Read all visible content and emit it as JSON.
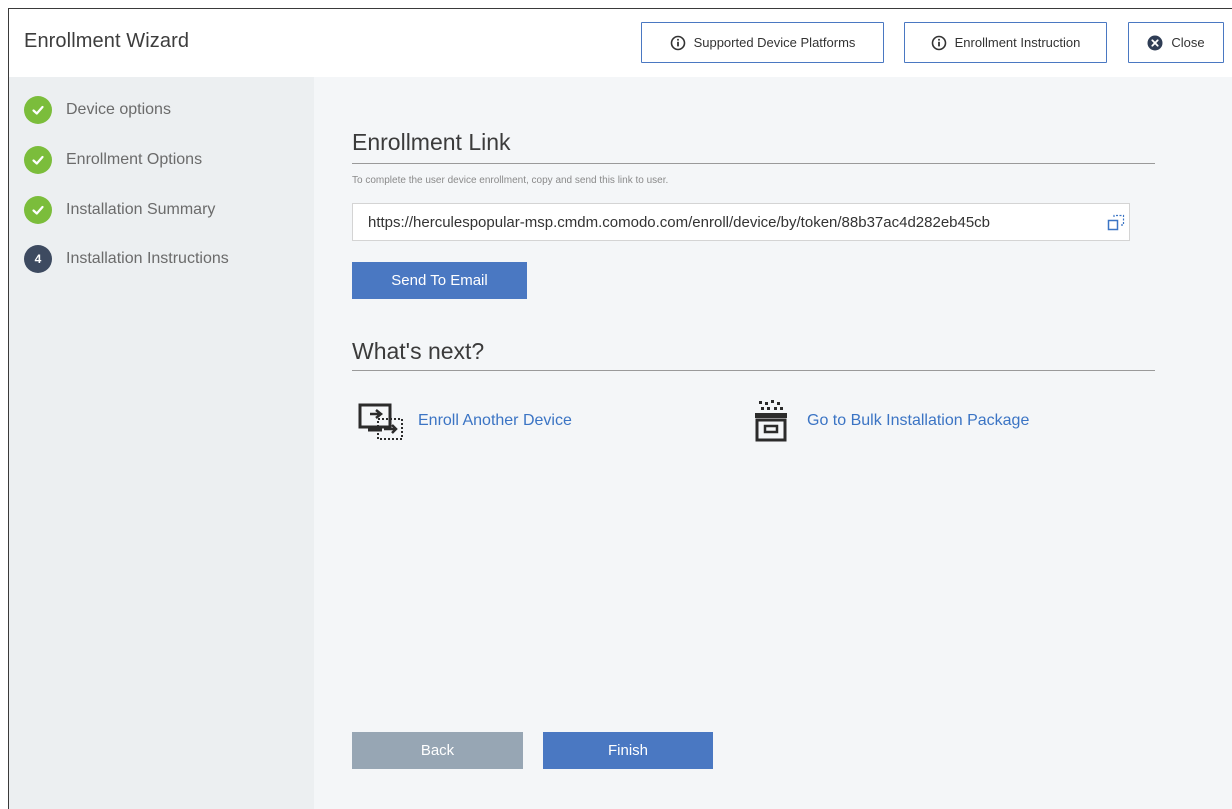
{
  "header": {
    "title": "Enrollment Wizard",
    "buttons": {
      "platforms": "Supported Device Platforms",
      "instruction": "Enrollment Instruction",
      "close": "Close"
    }
  },
  "sidebar": {
    "steps": [
      {
        "label": "Device options",
        "status": "done"
      },
      {
        "label": "Enrollment Options",
        "status": "done"
      },
      {
        "label": "Installation Summary",
        "status": "done"
      },
      {
        "label": "Installation Instructions",
        "status": "current",
        "number": "4"
      }
    ]
  },
  "main": {
    "enrollment_link": {
      "title": "Enrollment Link",
      "hint": "To complete the user device enrollment, copy and send this link to user.",
      "url": "https://herculespopular-msp.cmdm.comodo.com/enroll/device/by/token/88b37ac4d282eb45cb",
      "send_label": "Send To Email"
    },
    "whats_next": {
      "title": "What's next?",
      "actions": {
        "enroll_another": "Enroll Another Device",
        "bulk": "Go to Bulk Installation Package"
      }
    },
    "footer": {
      "back": "Back",
      "finish": "Finish"
    }
  },
  "colors": {
    "accent": "#4a78c2",
    "success": "#7bbd3b",
    "current_step": "#3d4a60",
    "back_button": "#97a6b4",
    "link": "#3b74c4"
  }
}
